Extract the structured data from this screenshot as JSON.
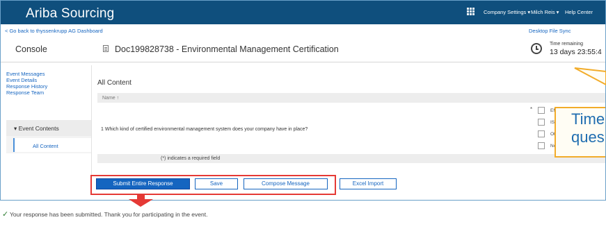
{
  "app": {
    "brand": "Ariba Sourcing"
  },
  "topnav": {
    "apps_icon": "grid-icon",
    "company_settings": "Company Settings ▾",
    "user": "Milch Reis ▾",
    "help": "Help Center"
  },
  "breadcrumb": {
    "back_link": "< Go back to thyssenkrupp AG Dashboard",
    "desktop_sync": "Desktop File Sync"
  },
  "header": {
    "console": "Console",
    "doc_title": "Doc199828738 - Environmental Management Certification",
    "time_remaining_label": "Time remaining",
    "time_remaining_value": "13 days 23:55:4"
  },
  "sidebar": {
    "links": [
      "Event Messages",
      "Event Details",
      "Response History",
      "Response Team"
    ],
    "event_contents": "▾ Event Contents",
    "all_content": "All Content"
  },
  "main": {
    "section_title": "All Content",
    "column_header": "Name ↑",
    "question": "1  Which kind of certified environmental management system does your company have in place?",
    "required_marker": "*",
    "options": [
      "EM",
      "IS",
      "Ot",
      "No"
    ],
    "required_note": "(*) indicates a required field"
  },
  "buttons": {
    "submit": "Submit Entire Response",
    "save": "Save",
    "compose": "Compose Message",
    "excel": "Excel Import"
  },
  "annotation": {
    "callout_line1": "Time",
    "callout_line2": "ques",
    "colors": {
      "outline": "#e53935",
      "callout_border": "#f2ac2a",
      "arrow": "#e53935"
    }
  },
  "confirmation": {
    "icon": "checkmark-icon",
    "message": "Your response has been submitted.  Thank you for participating in the event."
  }
}
